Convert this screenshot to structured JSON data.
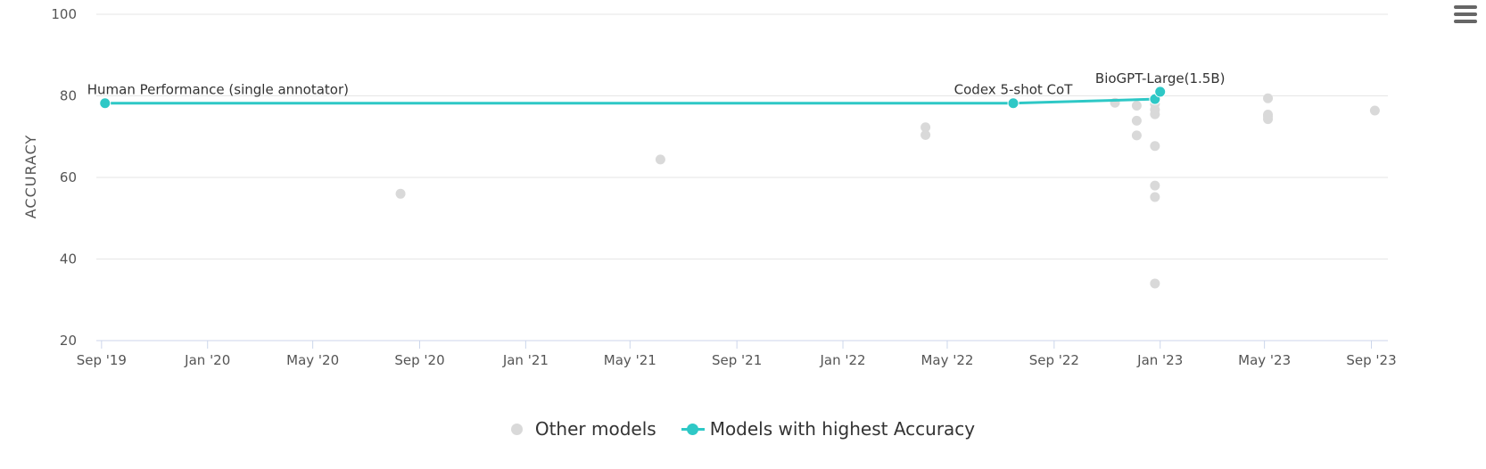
{
  "chart_data": {
    "type": "scatter",
    "ylabel": "ACCURACY",
    "ylim": [
      20,
      100
    ],
    "yticks": [
      20,
      40,
      60,
      80,
      100
    ],
    "xlim": [
      "2019-08-26",
      "2023-09-20"
    ],
    "xticks": [
      {
        "date": "2019-09-01",
        "label": "Sep '19"
      },
      {
        "date": "2020-01-01",
        "label": "Jan '20"
      },
      {
        "date": "2020-05-01",
        "label": "May '20"
      },
      {
        "date": "2020-09-01",
        "label": "Sep '20"
      },
      {
        "date": "2021-01-01",
        "label": "Jan '21"
      },
      {
        "date": "2021-05-01",
        "label": "May '21"
      },
      {
        "date": "2021-09-01",
        "label": "Sep '21"
      },
      {
        "date": "2022-01-01",
        "label": "Jan '22"
      },
      {
        "date": "2022-05-01",
        "label": "May '22"
      },
      {
        "date": "2022-09-01",
        "label": "Sep '22"
      },
      {
        "date": "2023-01-01",
        "label": "Jan '23"
      },
      {
        "date": "2023-05-01",
        "label": "May '23"
      },
      {
        "date": "2023-09-01",
        "label": "Sep '23"
      }
    ],
    "legend_position": "bottom-center",
    "grid": true,
    "series": [
      {
        "name": "Other models",
        "color": "#d9d9d9",
        "points": [
          {
            "x": "2020-08-10",
            "y": 56.0
          },
          {
            "x": "2021-06-05",
            "y": 64.4
          },
          {
            "x": "2022-04-06",
            "y": 72.3
          },
          {
            "x": "2022-04-06",
            "y": 70.4
          },
          {
            "x": "2022-11-10",
            "y": 78.3
          },
          {
            "x": "2022-12-05",
            "y": 77.6
          },
          {
            "x": "2022-12-05",
            "y": 73.9
          },
          {
            "x": "2022-12-05",
            "y": 70.3
          },
          {
            "x": "2022-12-26",
            "y": 78.0
          },
          {
            "x": "2022-12-26",
            "y": 76.6
          },
          {
            "x": "2022-12-26",
            "y": 75.5
          },
          {
            "x": "2022-12-26",
            "y": 67.7
          },
          {
            "x": "2022-12-26",
            "y": 58.0
          },
          {
            "x": "2022-12-26",
            "y": 55.2
          },
          {
            "x": "2022-12-26",
            "y": 34.0
          },
          {
            "x": "2023-05-05",
            "y": 79.4
          },
          {
            "x": "2023-05-05",
            "y": 75.4
          },
          {
            "x": "2023-05-05",
            "y": 74.3
          },
          {
            "x": "2023-05-05",
            "y": 75.0
          },
          {
            "x": "2023-09-05",
            "y": 76.4
          }
        ]
      },
      {
        "name": "Models with highest Accuracy",
        "color": "#2ec8c6",
        "points": [
          {
            "x": "2019-09-05",
            "y": 78.2,
            "label": "Human Performance (single annotator)"
          },
          {
            "x": "2022-07-16",
            "y": 78.2,
            "label": "Codex 5-shot CoT"
          },
          {
            "x": "2022-12-26",
            "y": 79.2,
            "label": ""
          },
          {
            "x": "2023-01-01",
            "y": 81.0,
            "label": "BioGPT-Large(1.5B)"
          }
        ]
      }
    ]
  },
  "legend": {
    "other_label": "Other models",
    "best_label": "Models with highest Accuracy"
  },
  "menu": {
    "icon": "hamburger-menu-icon"
  }
}
